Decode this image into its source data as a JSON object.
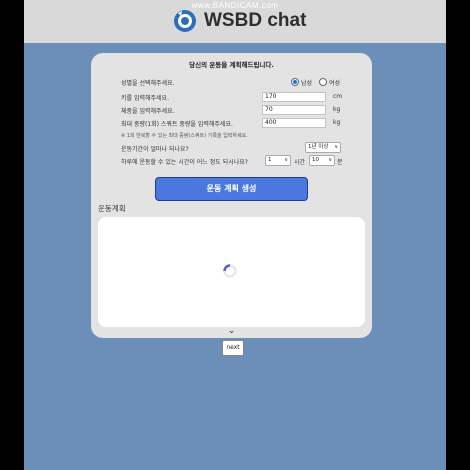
{
  "watermark": "www.BANDICAM.com",
  "brand": "WSBD chat",
  "form": {
    "title": "당신의 운동을 계획해드립니다.",
    "gender_label": "성별을 선택해주세요.",
    "gender_options": [
      "남성",
      "여성"
    ],
    "gender_selected": "남성",
    "height_label": "키를 입력해주세요.",
    "height_value": "170",
    "height_unit": "cm",
    "weight_label": "체중을 입력해주세요.",
    "weight_value": "70",
    "weight_unit": "kg",
    "squat_label": "최대 중량(1회) 스쿼트 중량을 입력해주세요.",
    "squat_value": "400",
    "squat_unit": "kg",
    "note": "※ 1회 반복할 수 있는 최대 중량(스쿼트) 기록을 입력하세요.",
    "period_label": "운동기간이 얼마나 되나요?",
    "period_value": "1년 이상",
    "time_label": "하루에 운동할 수 있는 시간이 어느 정도 되시나요?",
    "time_hours_value": "1",
    "time_hours_unit": "시간",
    "time_minutes_value": "10",
    "time_minutes_unit": "분",
    "generate_button": "운동 계획 생성",
    "plan_label": "운동계획"
  },
  "next_button": "next",
  "colors": {
    "page_bg": "#6b8fb8",
    "header_bg": "#d9d9d9",
    "card_bg": "#e3e3e3",
    "button_bg": "#4a78df"
  }
}
